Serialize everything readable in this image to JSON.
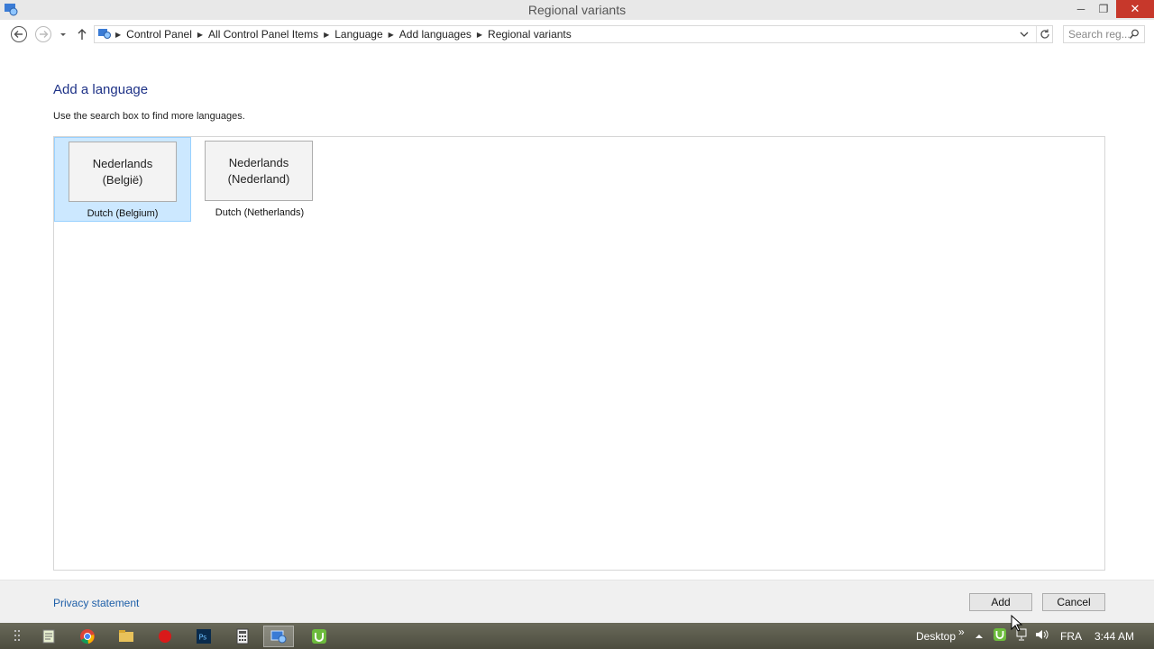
{
  "window": {
    "title": "Regional variants",
    "minimize": "─",
    "maximize": "❐",
    "close": "✕"
  },
  "address": {
    "crumbs": [
      "Control Panel",
      "All Control Panel Items",
      "Language",
      "Add languages",
      "Regional variants"
    ],
    "search_placeholder": "Search reg..."
  },
  "main": {
    "heading": "Add a language",
    "subtext": "Use the search box to find more languages.",
    "languages": [
      {
        "native_line1": "Nederlands",
        "native_line2": "(België)",
        "caption": "Dutch (Belgium)",
        "selected": true
      },
      {
        "native_line1": "Nederlands",
        "native_line2": "(Nederland)",
        "caption": "Dutch (Netherlands)",
        "selected": false
      }
    ]
  },
  "footer": {
    "privacy": "Privacy statement",
    "add": "Add",
    "cancel": "Cancel"
  },
  "taskbar": {
    "desktop": "Desktop",
    "chevrons": "»",
    "lang": "FRA",
    "time": "3:44 AM"
  }
}
